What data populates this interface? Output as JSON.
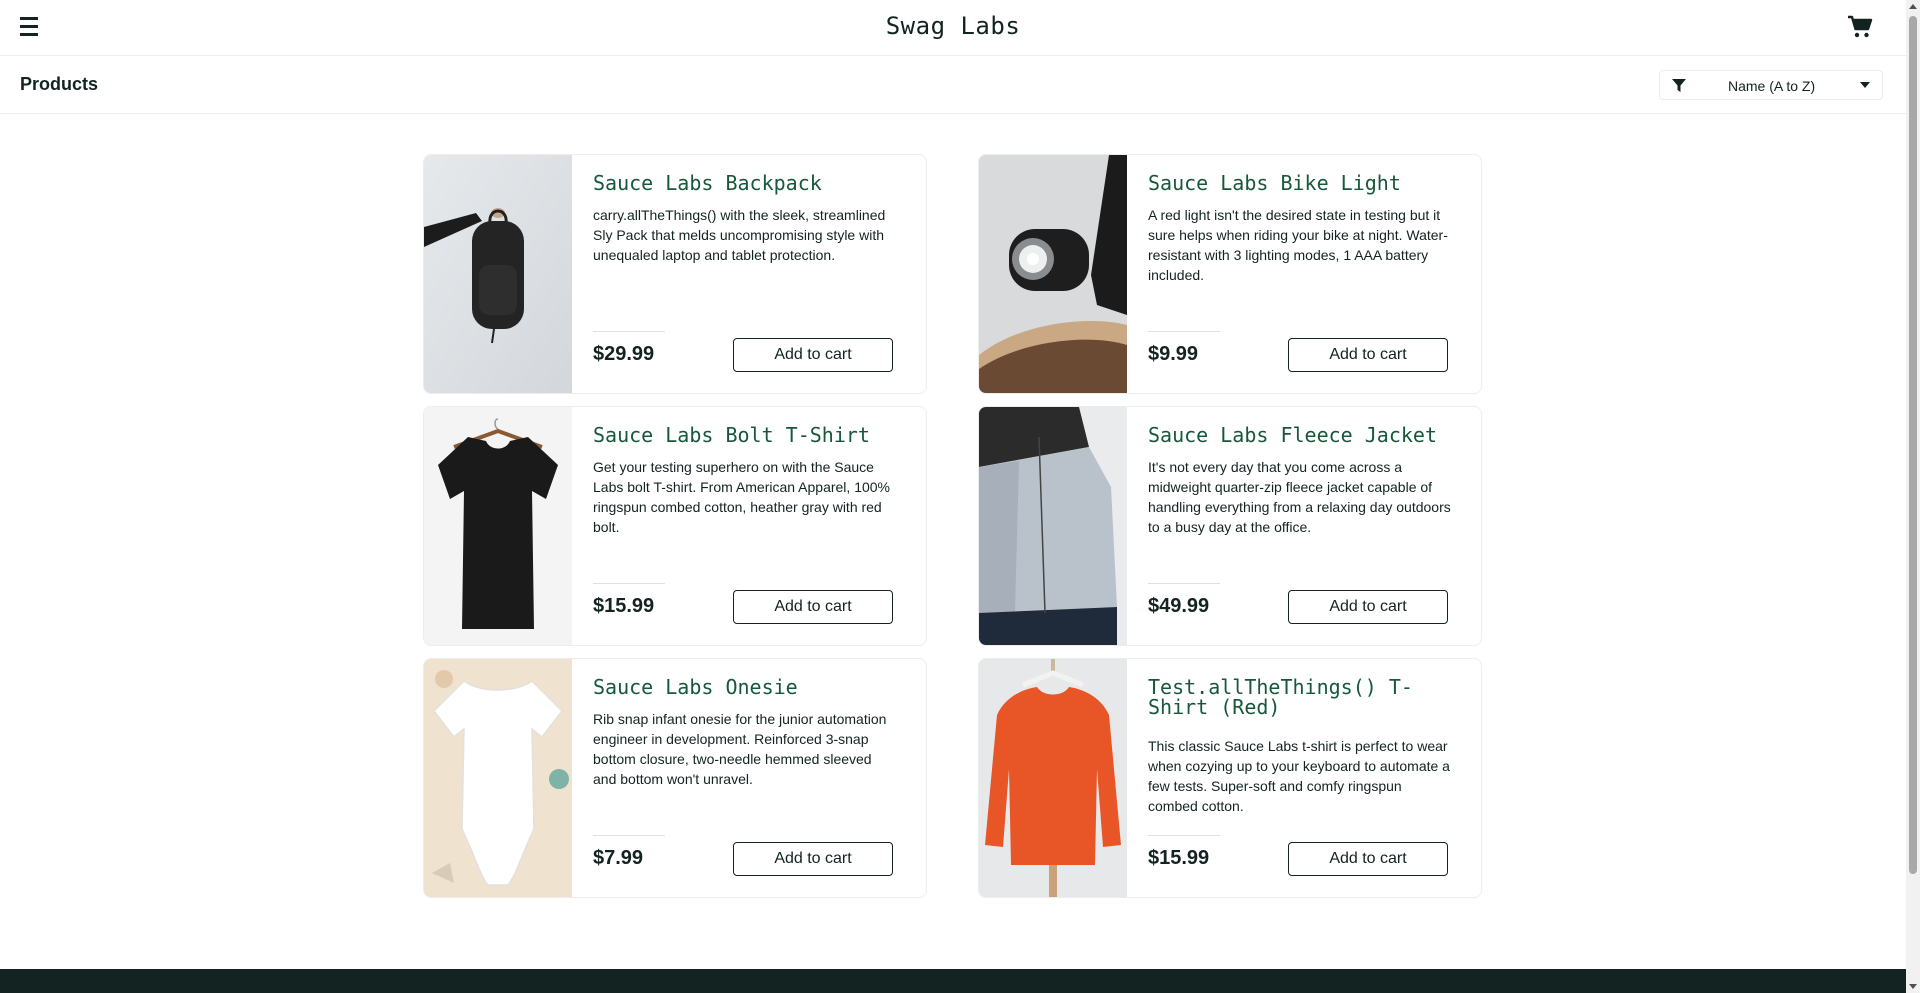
{
  "header": {
    "app_title": "Swag Labs",
    "menu_icon": "hamburger-menu-icon",
    "cart_icon": "shopping-cart-icon"
  },
  "sub_header": {
    "page_title": "Products",
    "sort": {
      "selected": "Name (A to Z)",
      "icon": "filter-icon"
    }
  },
  "products": [
    {
      "name": "Sauce Labs Backpack",
      "description": "carry.allTheThings() with the sleek, streamlined Sly Pack that melds uncompromising style with unequaled laptop and tablet protection.",
      "price": "$29.99",
      "button": "Add to cart"
    },
    {
      "name": "Sauce Labs Bike Light",
      "description": "A red light isn't the desired state in testing but it sure helps when riding your bike at night. Water-resistant with 3 lighting modes, 1 AAA battery included.",
      "price": "$9.99",
      "button": "Add to cart"
    },
    {
      "name": "Sauce Labs Bolt T-Shirt",
      "description": "Get your testing superhero on with the Sauce Labs bolt T-shirt. From American Apparel, 100% ringspun combed cotton, heather gray with red bolt.",
      "price": "$15.99",
      "button": "Add to cart"
    },
    {
      "name": "Sauce Labs Fleece Jacket",
      "description": "It's not every day that you come across a midweight quarter-zip fleece jacket capable of handling everything from a relaxing day outdoors to a busy day at the office.",
      "price": "$49.99",
      "button": "Add to cart"
    },
    {
      "name": "Sauce Labs Onesie",
      "description": "Rib snap infant onesie for the junior automation engineer in development. Reinforced 3-snap bottom closure, two-needle hemmed sleeved and bottom won't unravel.",
      "price": "$7.99",
      "button": "Add to cart"
    },
    {
      "name": "Test.allTheThings() T-Shirt (Red)",
      "description": "This classic Sauce Labs t-shirt is perfect to wear when cozying up to your keyboard to automate a few tests. Super-soft and comfy ringspun combed cotton.",
      "price": "$15.99",
      "button": "Add to cart"
    }
  ],
  "colors": {
    "brand_dark": "#132322",
    "product_name": "#18583a",
    "border": "#ededed"
  }
}
